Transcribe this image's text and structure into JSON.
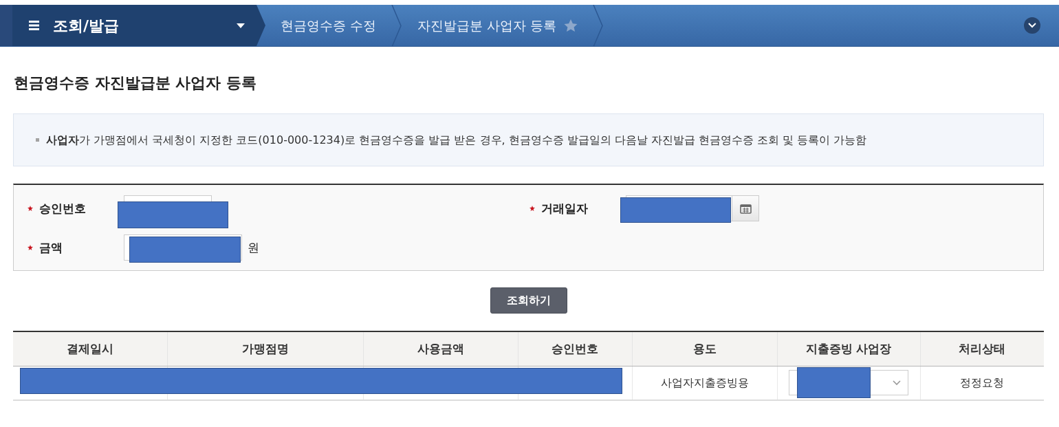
{
  "top_bar": {
    "menu_label": "조회/발급",
    "breadcrumbs": [
      {
        "label": "현금영수증 수정"
      },
      {
        "label": "자진발급분 사업자 등록",
        "starred": false
      }
    ]
  },
  "page_title": "현금영수증 자진발급분 사업자 등록",
  "notice": {
    "text": "**사업자**가 가맹점에서 국세청이 지정한 코드(010-000-1234)로 현금영수증을 발급 받은 경우, 현금영수증 발급일의 다음날 자진발급 현금영수증 조회 및 등록이 가능함"
  },
  "search_form": {
    "fields": [
      {
        "kind": "text",
        "label": "승인번호",
        "required": true,
        "redacted": true
      },
      {
        "kind": "date",
        "label": "거래일자",
        "required": true,
        "redacted": true
      },
      {
        "kind": "amount",
        "label": "금액",
        "required": true,
        "redacted": true,
        "unit": "원"
      }
    ]
  },
  "search_button": {
    "label": "조회하기"
  },
  "table": {
    "columns": [
      "결제일시",
      "가맹점명",
      "사용금액",
      "승인번호",
      "용도",
      "지출증빙 사업장",
      "처리상태"
    ],
    "rows": [
      {
        "cells": [
          {
            "kind": "redacted"
          },
          {
            "kind": "redacted"
          },
          {
            "kind": "redacted"
          },
          {
            "kind": "redacted"
          },
          {
            "kind": "text",
            "text": "사업자지출증빙용"
          },
          {
            "kind": "select",
            "redacted": true
          },
          {
            "kind": "text",
            "text": "정정요청"
          }
        ]
      }
    ]
  }
}
